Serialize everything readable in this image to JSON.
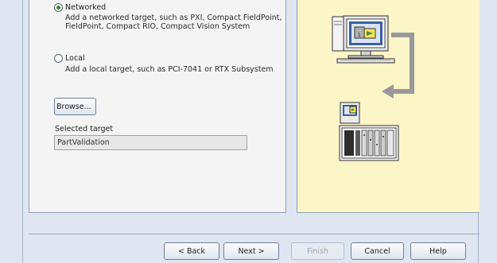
{
  "options": {
    "networked": {
      "label": "Networked",
      "description_line1": "Add a networked target, such as PXI, Compact FieldPoint,",
      "description_line2": "FieldPoint, Compact RIO, Compact Vision System",
      "selected": true
    },
    "local": {
      "label": "Local",
      "description": "Add a local target, such as PCI-7041 or RTX Subsystem",
      "selected": false
    }
  },
  "browse_label": "Browse...",
  "selected_target": {
    "label": "Selected target",
    "value": "PartValidation"
  },
  "illustration": {
    "monitor_badge": "1"
  },
  "buttons": {
    "back": "< Back",
    "next": "Next >",
    "finish": "Finish",
    "cancel": "Cancel",
    "help": "Help"
  },
  "colors": {
    "illustration_background": "#fbf5c8",
    "radio_selected": "#2d8a2d"
  }
}
